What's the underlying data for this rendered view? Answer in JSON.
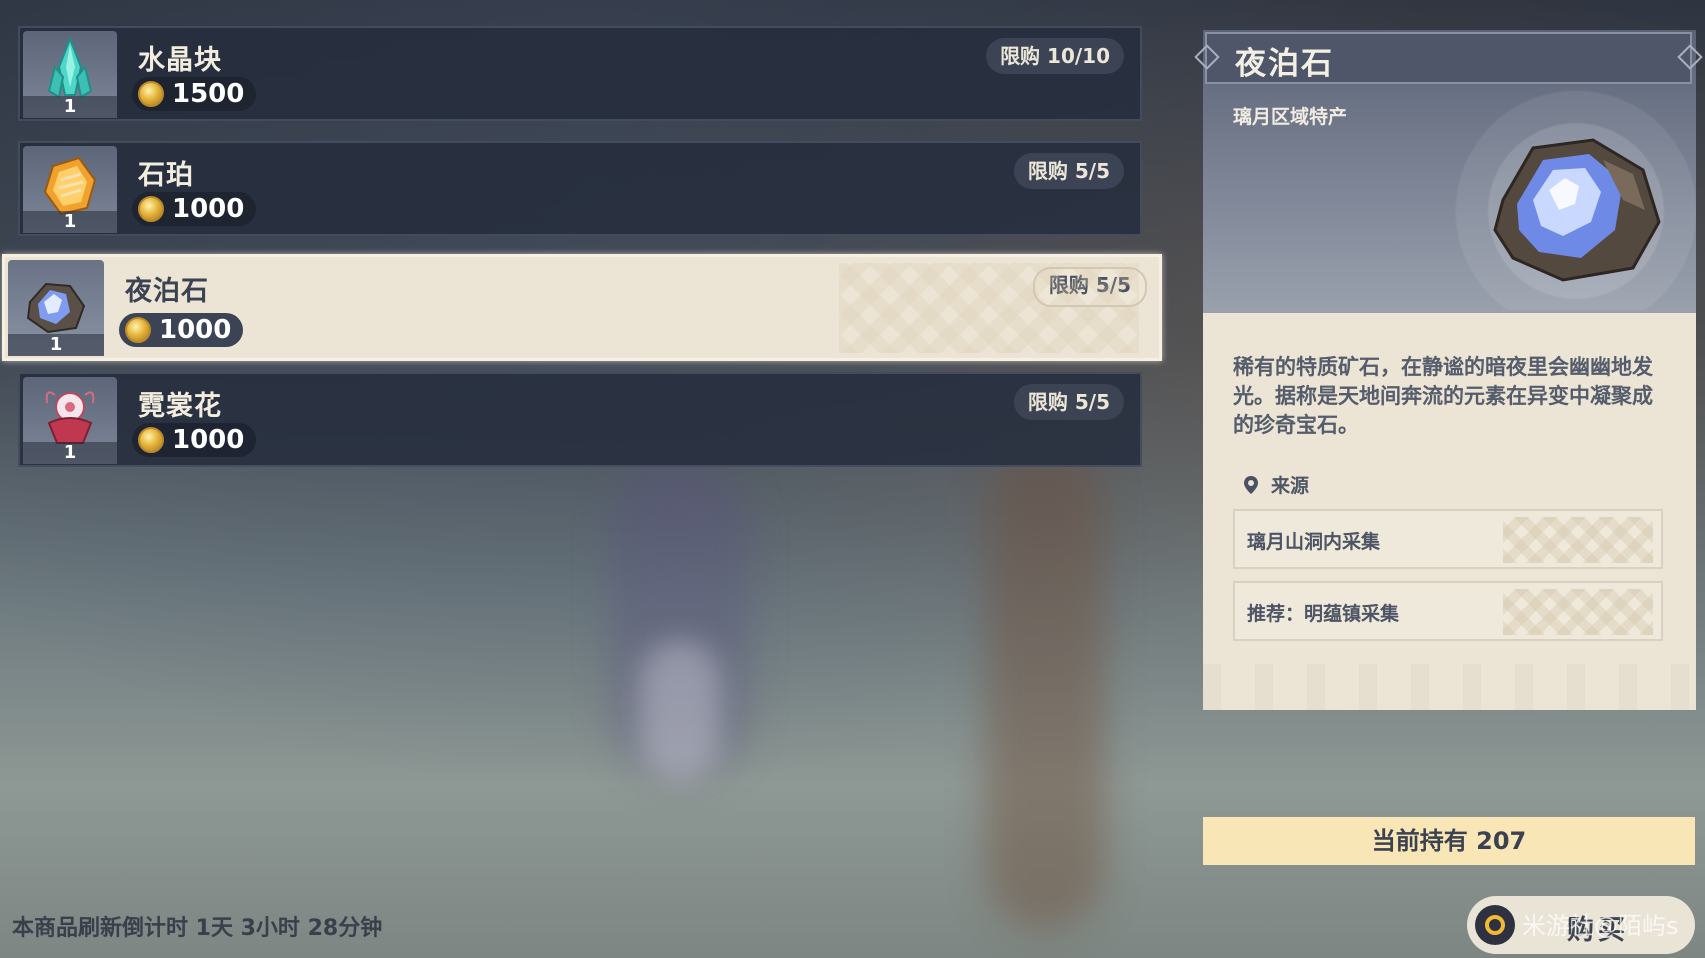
{
  "shop": {
    "items": [
      {
        "name": "水晶块",
        "count": "1",
        "price": "1500",
        "limit": "限购 10/10",
        "icon": "crystal-chunk-icon",
        "selected": false
      },
      {
        "name": "石珀",
        "count": "1",
        "price": "1000",
        "limit": "限购 5/5",
        "icon": "amber-stone-icon",
        "selected": false
      },
      {
        "name": "夜泊石",
        "count": "1",
        "price": "1000",
        "limit": "限购 5/5",
        "icon": "noctilucous-jade-icon",
        "selected": true
      },
      {
        "name": "霓裳花",
        "count": "1",
        "price": "1000",
        "limit": "限购 5/5",
        "icon": "silk-flower-icon",
        "selected": false
      }
    ],
    "currency_icon": "mora-coin-icon",
    "refresh_text": "本商品刷新倒计时 1天 3小时 28分钟"
  },
  "detail": {
    "title": "夜泊石",
    "subtitle": "璃月区域特产",
    "description": "稀有的特质矿石，在静谧的暗夜里会幽幽地发光。据称是天地间奔流的元素在异变中凝聚成的珍奇宝石。",
    "source_label": "来源",
    "sources": [
      "璃月山洞内采集",
      "推荐：明蕴镇采集"
    ]
  },
  "owned": "当前持有 207",
  "buy_label": "购买",
  "watermark": "米游社@陌屿s",
  "colors": {
    "selected_row": "#ece4d5",
    "row": "#262e3e",
    "owned_bar": "#f8e6b6",
    "coin": "#e6b53c"
  }
}
